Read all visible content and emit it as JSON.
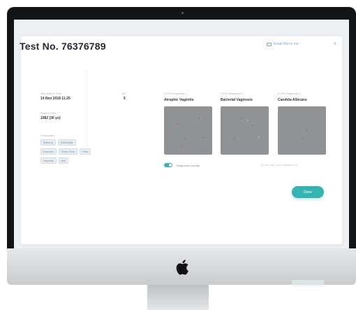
{
  "modal": {
    "title": "Test No. 76376789",
    "email_link": "Email this to me",
    "close_glyph": "×",
    "details": {
      "datetime_label": "Test Date & Time",
      "datetime_value": "14 Nov 2018 11:25",
      "ph_label": "pH",
      "ph_value": "5",
      "patient_label": "Patient YOB",
      "patient_value": "1982 (36 yo)",
      "complaints_label": "Complaints",
      "complaints": [
        "Burning",
        "Discharge",
        "Dryness",
        "Fishy Odor",
        "Pain",
        "Dryness",
        "Itch"
      ]
    },
    "diagnoses": [
      {
        "label": "KYRA Diagnosis 1",
        "name": "Atrophic Vaginitis"
      },
      {
        "label": "KYRA Diagnosis 2",
        "name": "Bacterial Vaginosis"
      },
      {
        "label": "KYRA Diagnosis 3",
        "name": "Candida Albicans"
      }
    ],
    "overlay_toggle_label": "Diagnoses overlay",
    "hint_text": "Tap an image for an enlarged view",
    "done_label": "Done"
  },
  "icons": {
    "mail": "mail-icon",
    "apple": "apple-logo-icon",
    "close": "close-icon"
  },
  "colors": {
    "accent": "#35b3b1",
    "link": "#7aa9c8",
    "bezel": "#121416"
  }
}
